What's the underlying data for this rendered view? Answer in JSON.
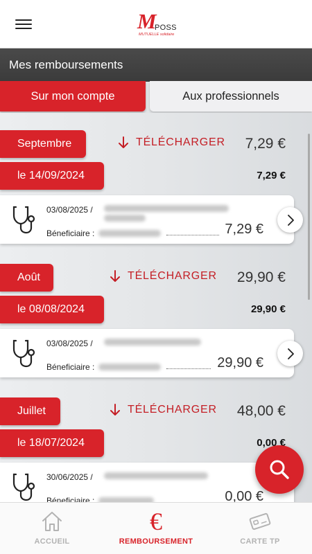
{
  "header": {
    "logo_m": "M",
    "logo_poss": "POSS",
    "logo_sub": "MUTUELLE solidaire"
  },
  "page": {
    "title": "Mes remboursements"
  },
  "tabs": [
    {
      "label": "Sur mon compte",
      "active": true
    },
    {
      "label": "Aux professionnels",
      "active": false
    }
  ],
  "download_label": "TÉLÉCHARGER",
  "beneficiary_label": "Béneficiaire :",
  "groups": [
    {
      "month": "Septembre",
      "month_total": "7,29 €",
      "payment_date": "le 14/09/2024",
      "payment_amount": "7,29 €",
      "card": {
        "date": "03/08/2025 /",
        "amount": "7,29 €"
      }
    },
    {
      "month": "Août",
      "month_total": "29,90 €",
      "payment_date": "le 08/08/2024",
      "payment_amount": "29,90 €",
      "card": {
        "date": "03/08/2025 /",
        "amount": "29,90 €"
      }
    },
    {
      "month": "Juillet",
      "month_total": "48,00 €",
      "payment_date": "le 18/07/2024",
      "payment_amount": "0,00 €",
      "card": {
        "date": "30/06/2025 /",
        "amount": "0,00 €"
      }
    }
  ],
  "nav": [
    {
      "label": "ACCUEIL",
      "icon": "home-icon",
      "active": false
    },
    {
      "label": "REMBOURSEMENT",
      "icon": "euro-icon",
      "active": true
    },
    {
      "label": "CARTE TP",
      "icon": "card-icon",
      "active": false
    }
  ],
  "colors": {
    "accent": "#d8232a",
    "header_bar": "#3f3f3f",
    "inactive_nav": "#b3b3b3"
  }
}
